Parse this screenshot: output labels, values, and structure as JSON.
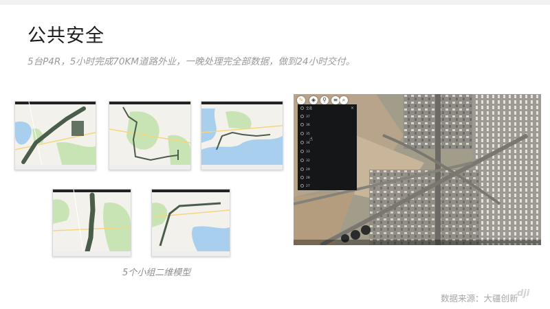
{
  "slide": {
    "title": "公共安全",
    "subtitle": "5台P4R，5小时完成70KM道路外业，一晚处理完全部数据，做到24小时交付。",
    "caption": "5个小组二维模型",
    "source": "数据来源：大疆创新",
    "logo_text": "dji"
  },
  "satellite_view": {
    "toolbar_icons": [
      "pencil-icon",
      "layers-icon",
      "location-icon",
      "menu-icon",
      "search-icon"
    ],
    "panel": {
      "close_label": "×",
      "items": [
        "全选",
        "37",
        "36",
        "35",
        "34",
        "33",
        "32",
        "29",
        "28",
        "27"
      ]
    }
  },
  "colors": {
    "title": "#1d1d1d",
    "subtitle": "#9a9a9a",
    "panel_bg": "#151617",
    "map_land": "#f2f1ec",
    "map_water": "#a8cfee",
    "map_green": "#c9e4b4",
    "route": "#4a5c4a"
  }
}
